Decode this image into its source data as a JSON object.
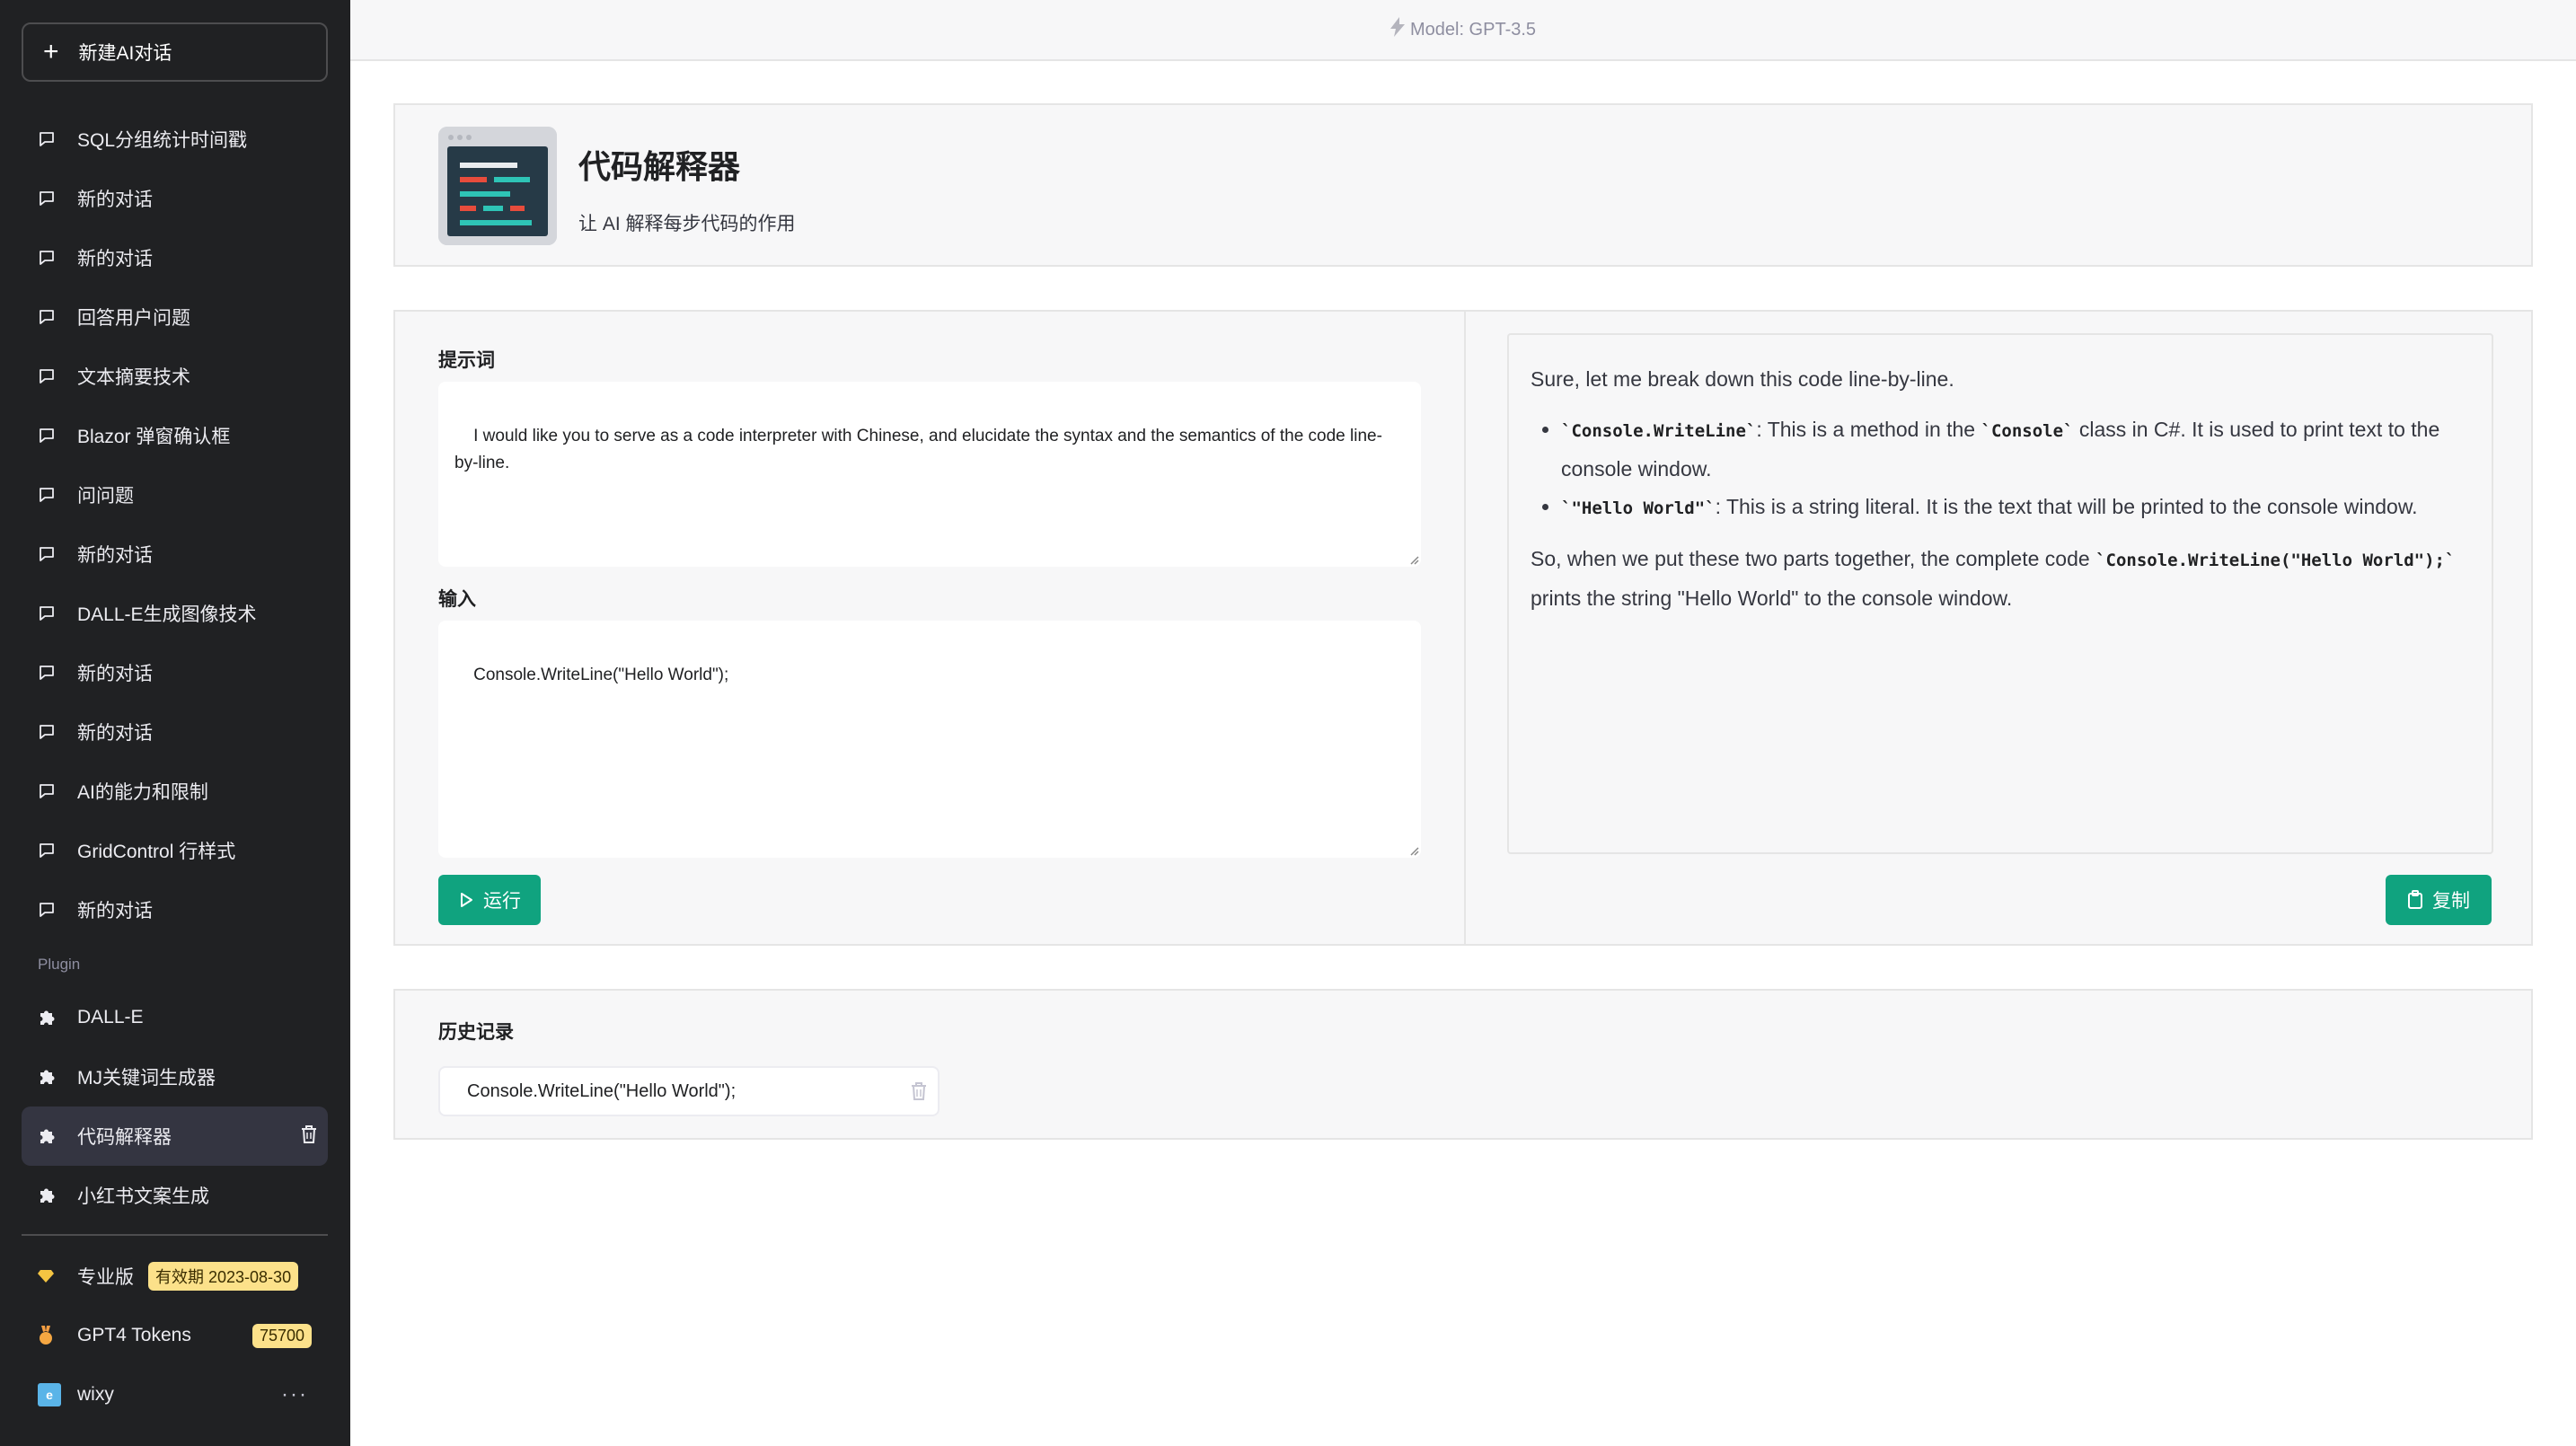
{
  "sidebar": {
    "new_chat_label": "新建AI对话",
    "chats": [
      "SQL分组统计时间戳",
      "新的对话",
      "新的对话",
      "回答用户问题",
      "文本摘要技术",
      "Blazor 弹窗确认框",
      "问问题",
      "新的对话",
      "DALL-E生成图像技术",
      "新的对话",
      "新的对话",
      "AI的能力和限制",
      "GridControl 行样式",
      "新的对话"
    ],
    "plugin_section_label": "Plugin",
    "plugins": [
      "DALL-E",
      "MJ关键词生成器",
      "代码解释器",
      "小红书文案生成"
    ],
    "active_plugin": "代码解释器",
    "plan_label": "专业版",
    "plan_badge": "有效期 2023-08-30",
    "tokens_label": "GPT4 Tokens",
    "tokens_badge": "75700",
    "user_name": "wixy",
    "user_avatar_letter": "e"
  },
  "topbar": {
    "model_label": "Model: GPT-3.5"
  },
  "app": {
    "title": "代码解释器",
    "description": "让 AI 解释每步代码的作用"
  },
  "prompt": {
    "label": "提示词",
    "value": "I would like you to serve as a code interpreter with Chinese, and elucidate the syntax and the semantics of the code line-by-line."
  },
  "input": {
    "label": "输入",
    "value": "Console.WriteLine(\"Hello World\");"
  },
  "run_button_label": "运行",
  "copy_button_label": "复制",
  "output": {
    "intro": "Sure, let me break down this code line-by-line.",
    "b1_code1": "`Console.WriteLine`",
    "b1_text1": ": This is a method in the ",
    "b1_code2": "`Console`",
    "b1_text2": " class in C#. It is used to print text to the console window.",
    "b2_code": "`\"Hello World\"`",
    "b2_text": ": This is a string literal. It is the text that will be printed to the console window.",
    "p2_text1": "So, when we put these two parts together, the complete code ",
    "p2_code": "`Console.WriteLine(\"Hello World\");`",
    "p2_text2": " prints the string \"Hello World\" to the console window."
  },
  "history": {
    "label": "历史记录",
    "items": [
      "Console.WriteLine(\"Hello World\");"
    ]
  },
  "colors": {
    "sidebar_bg": "#202123",
    "accent": "#10a37f",
    "badge": "#fce18a"
  }
}
